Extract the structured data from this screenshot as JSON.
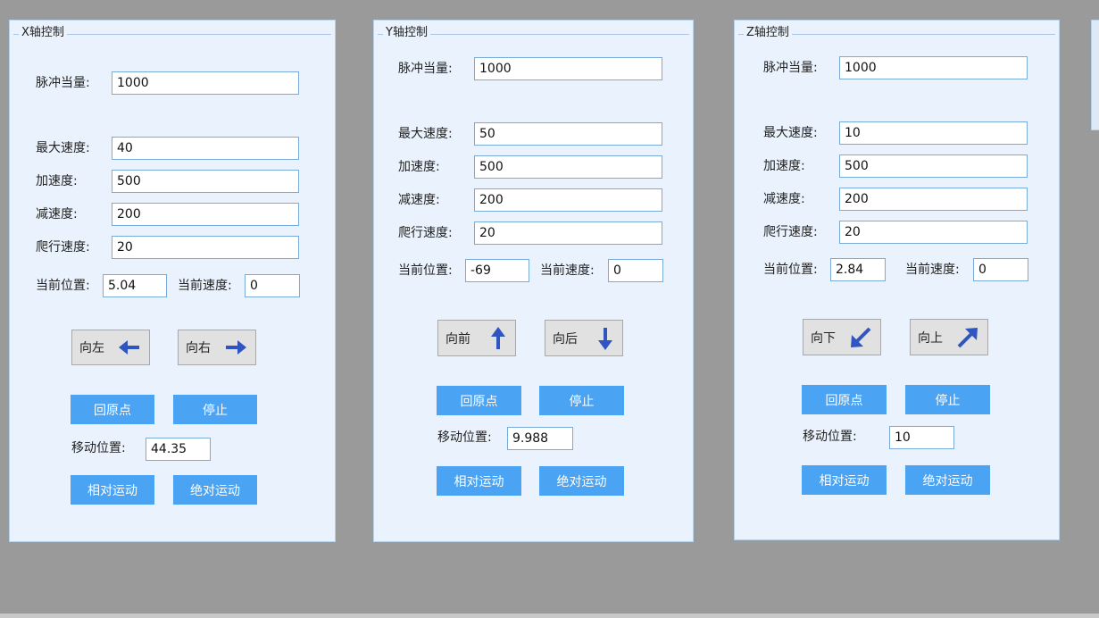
{
  "panels": [
    {
      "title": "X轴控制",
      "pulse_label": "脉冲当量:",
      "pulse": "1000",
      "maxspeed_label": "最大速度:",
      "maxspeed": "40",
      "accel_label": "加速度:",
      "accel": "500",
      "decel_label": "减速度:",
      "decel": "200",
      "creep_label": "爬行速度:",
      "creep": "20",
      "curpos_label": "当前位置:",
      "curpos": "5.04",
      "curspeed_label": "当前速度:",
      "curspeed": "0",
      "dir1": {
        "label": "向左",
        "icon": "arrow-left-icon"
      },
      "dir2": {
        "label": "向右",
        "icon": "arrow-right-icon"
      },
      "home_label": "回原点",
      "stop_label": "停止",
      "move_label": "移动位置:",
      "move": "44.35",
      "rel_label": "相对运动",
      "abs_label": "绝对运动"
    },
    {
      "title": "Y轴控制",
      "pulse_label": "脉冲当量:",
      "pulse": "1000",
      "maxspeed_label": "最大速度:",
      "maxspeed": "50",
      "accel_label": "加速度:",
      "accel": "500",
      "decel_label": "减速度:",
      "decel": "200",
      "creep_label": "爬行速度:",
      "creep": "20",
      "curpos_label": "当前位置:",
      "curpos": "-69",
      "curspeed_label": "当前速度:",
      "curspeed": "0",
      "dir1": {
        "label": "向前",
        "icon": "arrow-up-icon"
      },
      "dir2": {
        "label": "向后",
        "icon": "arrow-down-icon"
      },
      "home_label": "回原点",
      "stop_label": "停止",
      "move_label": "移动位置:",
      "move": "9.988",
      "rel_label": "相对运动",
      "abs_label": "绝对运动"
    },
    {
      "title": "Z轴控制",
      "pulse_label": "脉冲当量:",
      "pulse": "1000",
      "maxspeed_label": "最大速度:",
      "maxspeed": "10",
      "accel_label": "加速度:",
      "accel": "500",
      "decel_label": "减速度:",
      "decel": "200",
      "creep_label": "爬行速度:",
      "creep": "20",
      "curpos_label": "当前位置:",
      "curpos": "2.84",
      "curspeed_label": "当前速度:",
      "curspeed": "0",
      "dir1": {
        "label": "向下",
        "icon": "arrow-down-left-icon"
      },
      "dir2": {
        "label": "向上",
        "icon": "arrow-up-right-icon"
      },
      "home_label": "回原点",
      "stop_label": "停止",
      "move_label": "移动位置:",
      "move": "10",
      "rel_label": "相对运动",
      "abs_label": "绝对运动"
    }
  ],
  "colors": {
    "background": "#9a9a9a",
    "panel": "#eaf3fd",
    "primary_button": "#4aa3f3",
    "arrow": "#2f56c0",
    "direction_button": "#e1e1e1"
  }
}
